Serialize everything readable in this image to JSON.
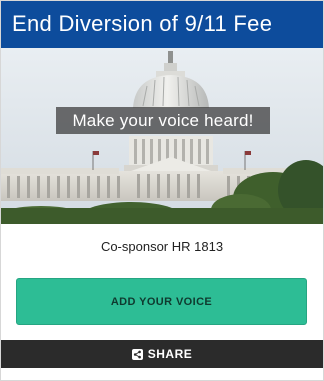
{
  "header": {
    "title": "End Diversion of 9/11 Fee",
    "background_color": "#0d4c9c"
  },
  "hero": {
    "image_icon": "capitol-building-image",
    "tagline": "Make your voice heard!"
  },
  "subtitle": "Co-sponsor HR 1813",
  "cta": {
    "label": "ADD YOUR VOICE",
    "color": "#2dbd95"
  },
  "share": {
    "label": "SHARE",
    "icon": "share-icon",
    "background_color": "#2b2b2b"
  }
}
